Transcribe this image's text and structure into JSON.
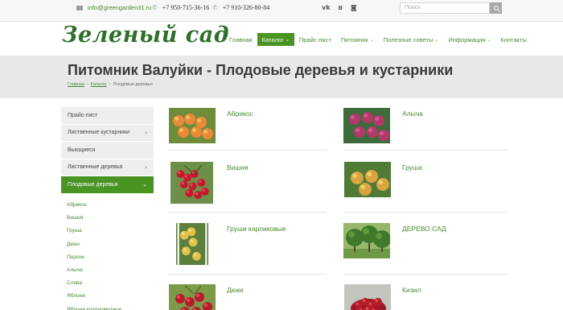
{
  "topbar": {
    "email": "info@greengarden31.ru",
    "phone1": "+7 950-715-36-16",
    "phone2": "+7 910-326-80-84",
    "social": [
      "vk-icon",
      "odnoklassniki-icon",
      "instagram-icon"
    ],
    "search_placeholder": "Поиск"
  },
  "header": {
    "logo": "Зеленый сад",
    "nav": [
      {
        "label": "Главная",
        "dropdown": false,
        "active": false
      },
      {
        "label": "Каталог",
        "dropdown": true,
        "active": true
      },
      {
        "label": "Прайс-лист",
        "dropdown": false,
        "active": false
      },
      {
        "label": "Питомник",
        "dropdown": true,
        "active": false
      },
      {
        "label": "Полезные советы",
        "dropdown": true,
        "active": false
      },
      {
        "label": "Информация",
        "dropdown": true,
        "active": false
      },
      {
        "label": "Контакты",
        "dropdown": false,
        "active": false
      }
    ]
  },
  "banner": {
    "title": "Питомник Валуйки - Плодовые деревья и кустарники",
    "breadcrumb": [
      "Главная",
      "Каталог",
      "Плодовые деревья"
    ]
  },
  "sidebar": {
    "items": [
      {
        "label": "Прайс-лист",
        "chevron": false
      },
      {
        "label": "Лиственные кустарники",
        "chevron": true
      },
      {
        "label": "Вьющиеся",
        "chevron": false
      },
      {
        "label": "Лиственные деревья",
        "chevron": true
      },
      {
        "label": "Плодовые деревья",
        "chevron": true,
        "active": true
      }
    ],
    "subitems": [
      "Абрикос",
      "Вишня",
      "Груша",
      "Дюки",
      "Персик",
      "Алыча",
      "Слива",
      "Яблоня",
      "Яблоня колоновидные"
    ]
  },
  "products": [
    {
      "name": "Абрикос"
    },
    {
      "name": "Алыча"
    },
    {
      "name": "Вишня"
    },
    {
      "name": "Груша"
    },
    {
      "name": "Груши карликовые"
    },
    {
      "name": "ДЕРЕВО САД"
    },
    {
      "name": "Дюки"
    },
    {
      "name": "Кизил"
    }
  ],
  "colors": {
    "accent": "#4a9424",
    "link": "#4a8a32",
    "logo": "#2e6f2a",
    "banner": "#e7e9e8"
  }
}
